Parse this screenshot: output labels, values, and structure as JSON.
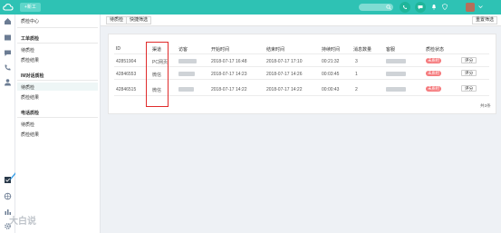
{
  "topbar": {
    "tab_label": "+新工"
  },
  "sidebar": {
    "header": "质检中心",
    "groups": [
      {
        "title": "工单质检",
        "items": [
          "待质检",
          "质检结果"
        ]
      },
      {
        "title": "IM对话质检",
        "items": [
          "待质检",
          "质检结果"
        ]
      },
      {
        "title": "电话质检",
        "items": [
          "待质检",
          "质检结果"
        ]
      }
    ]
  },
  "breadcrumbs": [
    "待质检",
    "快捷筛选"
  ],
  "reset_filter_label": "重置筛选",
  "table": {
    "columns": [
      "ID",
      "渠道",
      "访客",
      "开始时间",
      "结束时间",
      "持续时间",
      "消息数量",
      "客服",
      "质检状态"
    ],
    "rows": [
      {
        "id": "42851904",
        "channel": "PC网页",
        "start": "2018-07-17 16:48",
        "end": "2018-07-17 17:10",
        "duration": "00:21:32",
        "messages": "3",
        "status": "未质检",
        "action": "评分"
      },
      {
        "id": "42846553",
        "channel": "微信",
        "start": "2018-07-17 14:23",
        "end": "2018-07-17 14:26",
        "duration": "00:03:45",
        "messages": "1",
        "status": "未质检",
        "action": "评分"
      },
      {
        "id": "42846515",
        "channel": "微信",
        "start": "2018-07-17 14:22",
        "end": "2018-07-17 14:22",
        "duration": "00:00:43",
        "messages": "2",
        "status": "未质检",
        "action": "评分"
      }
    ],
    "total": "共3条"
  },
  "watermark": "大白说",
  "colors": {
    "topbar": "#2ec2b4",
    "badge": "#f5777a",
    "highlight": "#e02b2b"
  }
}
